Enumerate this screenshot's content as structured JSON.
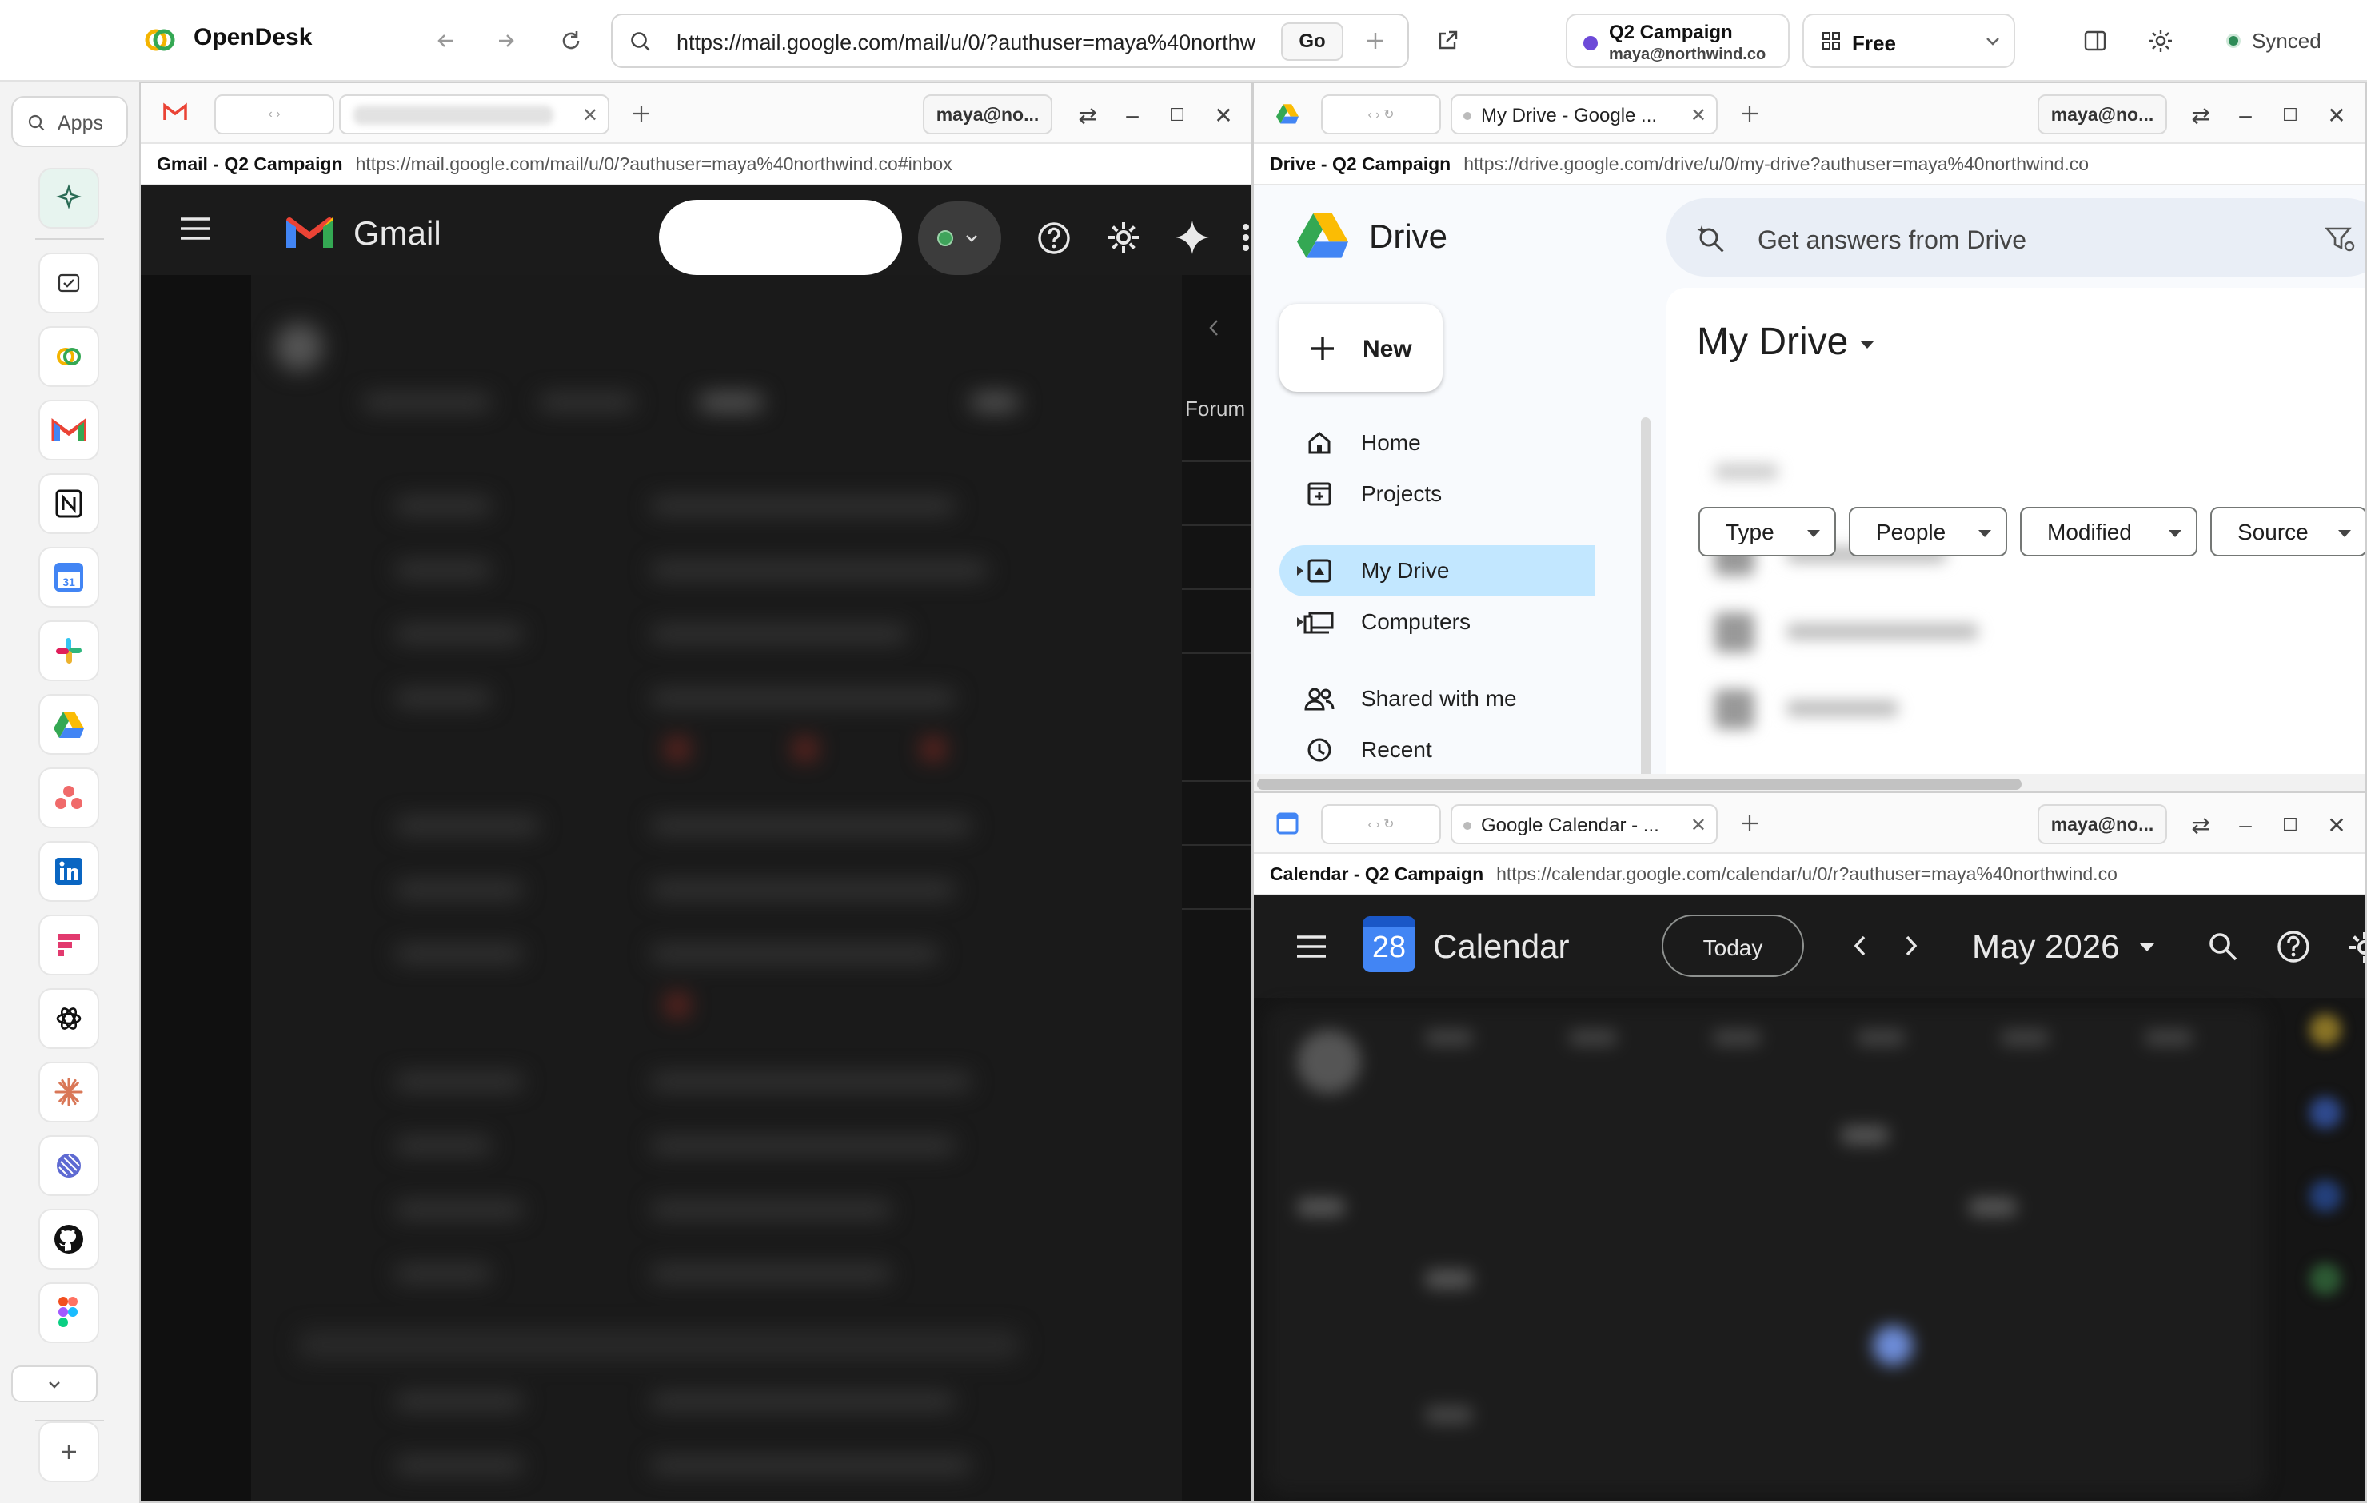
{
  "app": {
    "name": "OpenDesk",
    "url": "https://mail.google.com/mail/u/0/?authuser=maya%40northw",
    "go_label": "Go",
    "workspace_name": "Q2 Campaign",
    "workspace_email": "maya@northwind.co",
    "plan_label": "Free",
    "sync_status": "Synced"
  },
  "dock": {
    "search_label": "Apps",
    "apps": [
      "OpenDesk AI",
      "Tasks",
      "OpenDesk",
      "Gmail",
      "Notion",
      "Google Calendar",
      "Slack",
      "Google Drive",
      "Asana",
      "LinkedIn",
      "Productboard",
      "ChatGPT",
      "Claude",
      "Linear",
      "GitHub",
      "Figma"
    ]
  },
  "gmail_panel": {
    "profile": "maya@no...",
    "page_title": "Gmail - Q2 Campaign",
    "page_url": "https://mail.google.com/mail/u/0/?authuser=maya%40northwind.co#inbox",
    "app_name": "Gmail",
    "tab_forums": "Forum"
  },
  "drive_panel": {
    "tab_title": "My Drive - Google ...",
    "profile": "maya@no...",
    "page_title": "Drive - Q2 Campaign",
    "page_url": "https://drive.google.com/drive/u/0/my-drive?authuser=maya%40northwind.co",
    "app_name": "Drive",
    "search_placeholder": "Get answers from Drive",
    "new_label": "New",
    "nav": {
      "home": "Home",
      "projects": "Projects",
      "my_drive": "My Drive",
      "computers": "Computers",
      "shared": "Shared with me",
      "recent": "Recent"
    },
    "heading": "My Drive",
    "filters": [
      "Type",
      "People",
      "Modified",
      "Source"
    ]
  },
  "calendar_panel": {
    "tab_title": "Google Calendar - ...",
    "profile": "maya@no...",
    "page_title": "Calendar - Q2 Campaign",
    "page_url": "https://calendar.google.com/calendar/u/0/r?authuser=maya%40northwind.co",
    "app_name": "Calendar",
    "date_badge": "28",
    "today_label": "Today",
    "month_label": "May 2026"
  },
  "colors": {
    "accent": "#1a73e8",
    "gmail_bg": "#131313",
    "calendar_bg": "#1b1b1b",
    "drive_selected": "#c2e7ff",
    "workspace_dot": "#6d4ad8",
    "synced_dot": "#2e8b57"
  }
}
